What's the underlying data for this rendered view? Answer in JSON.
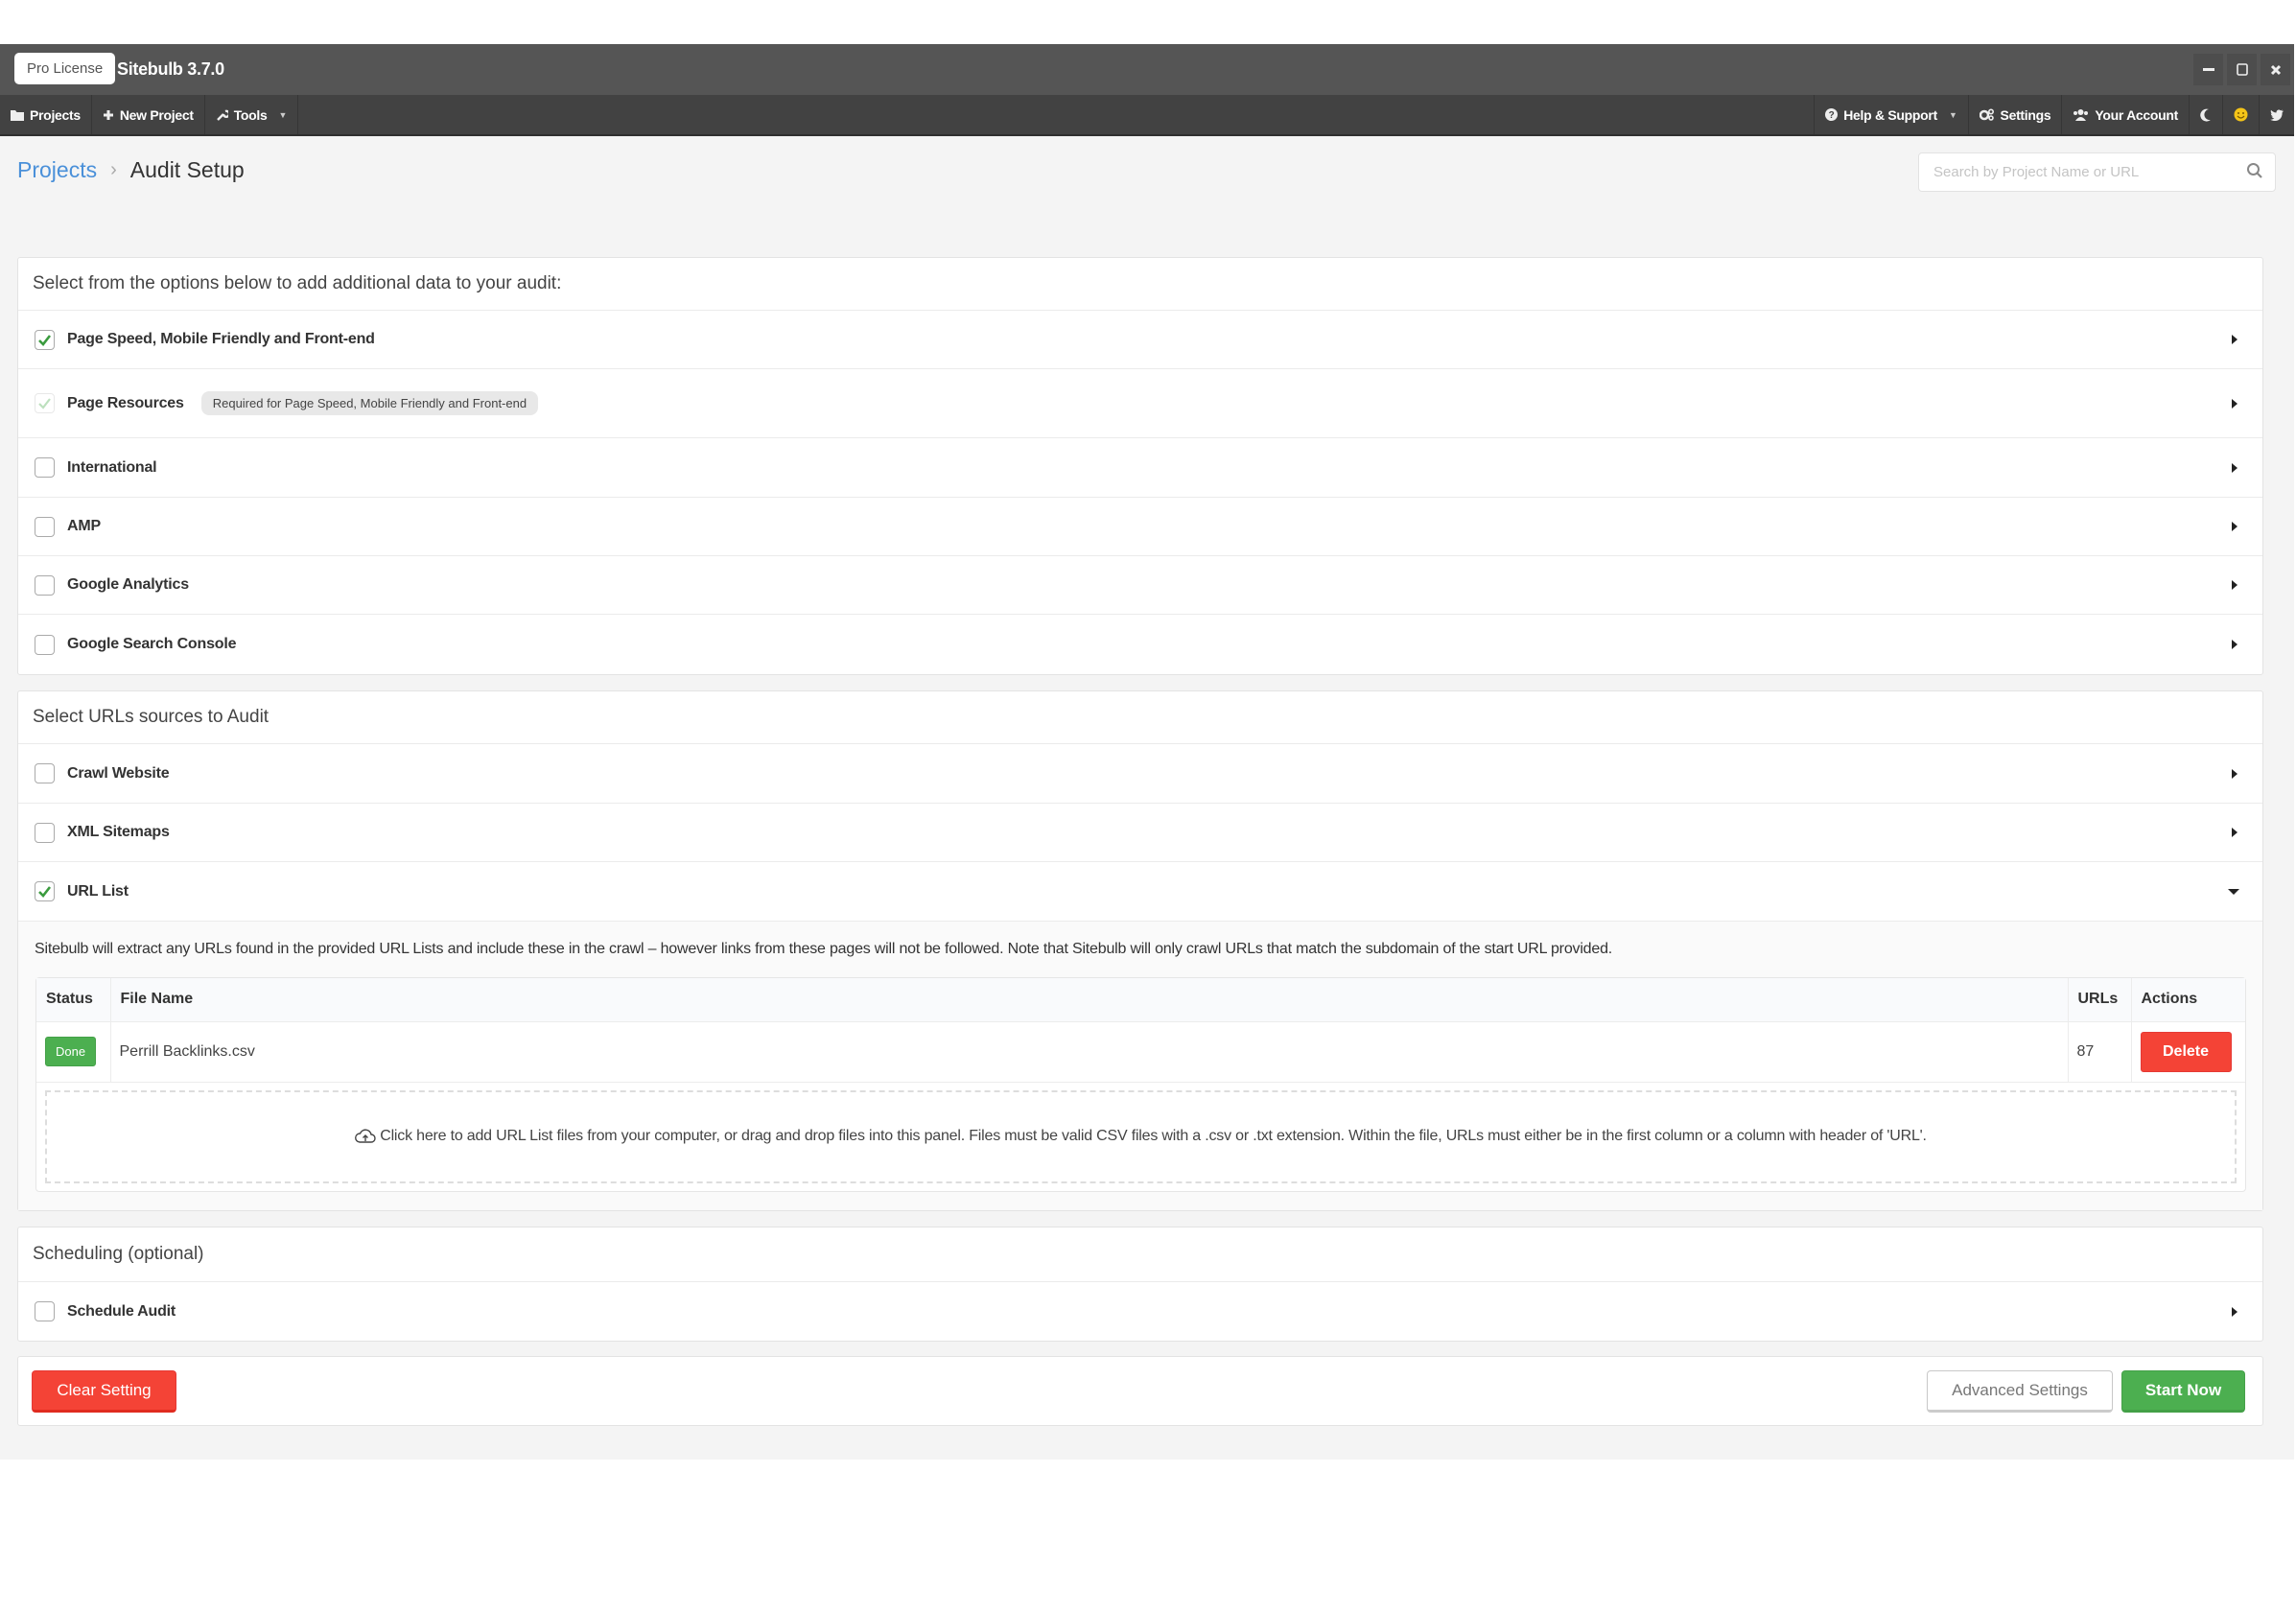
{
  "titlebar": {
    "license": "Pro License",
    "app_title": "Sitebulb 3.7.0",
    "window_buttons": [
      "minimize-icon",
      "maximize-icon",
      "close-icon"
    ]
  },
  "navbar": {
    "left": [
      {
        "label": "Projects",
        "icon": "folder-icon"
      },
      {
        "label": "New Project",
        "icon": "plus-icon"
      },
      {
        "label": "Tools",
        "icon": "wrench-icon",
        "dropdown": true
      }
    ],
    "right": [
      {
        "label": "Help & Support",
        "icon": "question-circle-icon",
        "dropdown": true
      },
      {
        "label": "Settings",
        "icon": "gears-icon"
      },
      {
        "label": "Your Account",
        "icon": "users-icon"
      },
      {
        "label": "",
        "icon": "moon-icon"
      },
      {
        "label": "",
        "icon": "smiley-icon"
      },
      {
        "label": "",
        "icon": "twitter-icon"
      }
    ]
  },
  "breadcrumb": {
    "parent": "Projects",
    "separator": "›",
    "current": "Audit Setup"
  },
  "search": {
    "placeholder": "Search by Project Name or URL",
    "value": ""
  },
  "additional_data": {
    "heading": "Select from the options below to add additional data to your audit:",
    "options": [
      {
        "label": "Page Speed, Mobile Friendly and Front-end",
        "checked": true
      },
      {
        "label": "Page Resources",
        "checked": true,
        "disabled": true,
        "badge": "Required for Page Speed, Mobile Friendly and Front-end"
      },
      {
        "label": "International",
        "checked": false
      },
      {
        "label": "AMP",
        "checked": false
      },
      {
        "label": "Google Analytics",
        "checked": false
      },
      {
        "label": "Google Search Console",
        "checked": false
      }
    ]
  },
  "url_sources": {
    "heading": "Select URLs sources to Audit",
    "options": [
      {
        "label": "Crawl Website",
        "checked": false
      },
      {
        "label": "XML Sitemaps",
        "checked": false
      },
      {
        "label": "URL List",
        "checked": true,
        "expanded": true
      }
    ],
    "url_list": {
      "description": "Sitebulb will extract any URLs found in the provided URL Lists and include these in the crawl – however links from these pages will not be followed. Note that Sitebulb will only crawl URLs that match the subdomain of the start URL provided.",
      "columns": [
        "Status",
        "File Name",
        "URLs",
        "Actions"
      ],
      "rows": [
        {
          "status": "Done",
          "file_name": "Perrill Backlinks.csv",
          "urls": "87",
          "action": "Delete"
        }
      ],
      "dropzone_text": "Click here to add URL List files from your computer, or drag and drop files into this panel. Files must be valid CSV files with a .csv or .txt extension. Within the file, URLs must either be in the first column or a column with header of 'URL'."
    }
  },
  "scheduling": {
    "heading": "Scheduling (optional)",
    "options": [
      {
        "label": "Schedule Audit",
        "checked": false
      }
    ]
  },
  "footer_actions": {
    "clear": "Clear Setting",
    "advanced": "Advanced Settings",
    "start": "Start Now"
  },
  "colors": {
    "accent_link": "#4a90d9",
    "success": "#4caf50",
    "danger": "#f44336",
    "titlebar": "#555555",
    "navbar": "#424242"
  }
}
